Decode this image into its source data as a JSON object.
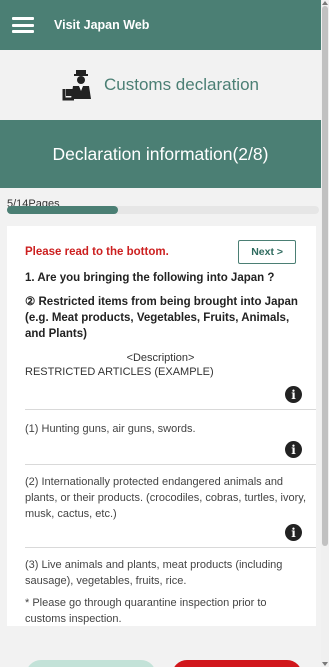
{
  "header": {
    "app_title": "Visit Japan Web"
  },
  "customs": {
    "title": "Customs declaration"
  },
  "section": {
    "title": "Declaration information(2/8)"
  },
  "progress": {
    "label": "5/14Pages",
    "current": 5,
    "total": 14
  },
  "card": {
    "warning": "Please read to the bottom.",
    "next_label": "Next >",
    "question": "1. Are you bringing the following into Japan ?",
    "subquestion": "② Restricted items from being brought into Japan (e.g. Meat products, Vegetables, Fruits, Animals, and Plants)",
    "description_heading": "<Description>",
    "restricted_heading": "RESTRICTED ARTICLES (EXAMPLE)",
    "items": [
      "(1) Hunting guns, air guns, swords.",
      "(2) Internationally protected endangered animals and plants, or their products. (crocodiles, cobras, turtles, ivory, musk, cactus, etc.)",
      "(3) Live animals and plants, meat products (including sausage), vegetables, fruits, rice."
    ],
    "note": "* Please go through quarantine inspection prior to customs inspection."
  },
  "icons": {
    "menu": "hamburger-icon",
    "officer": "customs-officer-icon",
    "info": "info-icon"
  },
  "colors": {
    "brand": "#4b7f74",
    "warning": "#cc1f1f",
    "danger_button": "#d1171c",
    "back_button": "#c3e2d8"
  }
}
